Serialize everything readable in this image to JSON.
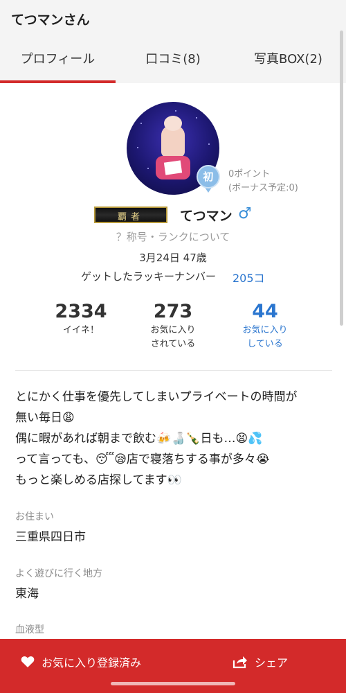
{
  "header": {
    "title": "てつマンさん"
  },
  "tabs": [
    {
      "label": "プロフィール",
      "active": true
    },
    {
      "label": "口コミ(8)",
      "active": false
    },
    {
      "label": "写真BOX(2)",
      "active": false
    }
  ],
  "profile": {
    "badge_label": "初",
    "points_line1": "0ポイント",
    "points_line2": "(ボーナス予定:0)",
    "rank_title": "覇者",
    "name": "てつマン",
    "gender_symbol": "♂",
    "title_link": "？称号・ランクについて",
    "birthday": "3月24日 47歳",
    "lucky_label": "ゲットしたラッキーナンバー",
    "lucky_count": "205コ"
  },
  "stats": [
    {
      "value": "2334",
      "label_line1": "イイネ！",
      "label_line2": ""
    },
    {
      "value": "273",
      "label_line1": "お気に入り",
      "label_line2": "されている"
    },
    {
      "value": "44",
      "label_line1": "お気に入り",
      "label_line2": "している"
    }
  ],
  "bio": {
    "lines": [
      "とにかく仕事を優先してしまいプライベートの時間が",
      "無い毎日😩",
      "偶に暇があれば朝まで飲む🍻🍶🍾日も…😫💦",
      "って言っても、😴😪店で寝落ちする事が多々😭",
      "もっと楽しめる店探してます👀"
    ]
  },
  "details": {
    "residence_label": "お住まい",
    "residence_value": "三重県四日市",
    "area_label": "よく遊びに行く地方",
    "area_value": "東海",
    "blood_label": "血液型"
  },
  "bottom_bar": {
    "favorite_label": "お気に入り登録済み",
    "share_label": "シェア"
  },
  "colors": {
    "accent_red": "#d32a2a",
    "link_blue": "#2b76cf",
    "gender_blue": "#3a8fd8"
  }
}
